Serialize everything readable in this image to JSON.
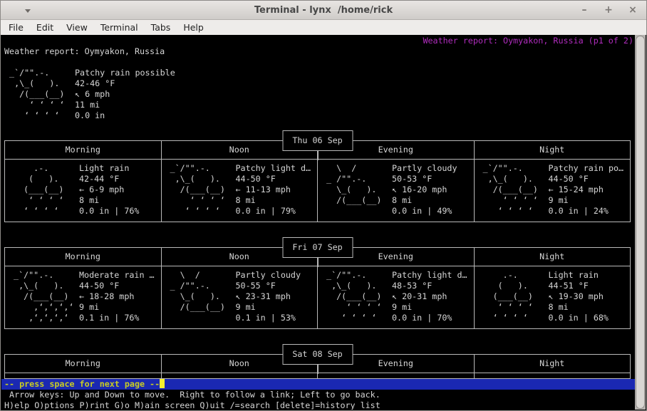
{
  "window": {
    "title": "Terminal - lynx  /home/rick",
    "controls": {
      "minimize": "–",
      "maximize": "+",
      "close": "×"
    }
  },
  "menu": {
    "items": [
      "File",
      "Edit",
      "View",
      "Terminal",
      "Tabs",
      "Help"
    ]
  },
  "lynx": {
    "page_title": "Weather report: Oymyakon, Russia (p1 of 2)",
    "status": "-- press space for next page --",
    "help_line1": " Arrow keys: Up and Down to move.  Right to follow a link; Left to go back.",
    "help_line2": "H)elp O)ptions P)rint G)o M)ain screen Q)uit /=search [delete]=history list"
  },
  "weather": {
    "heading": "Weather report: Oymyakon, Russia",
    "art": {
      "patchy_rain": [
        " _`/\"\".-.",
        "  ,\\_(   ).",
        "   /(___(__)",
        "     ‘ ‘ ‘ ‘",
        "    ‘ ‘ ‘ ‘"
      ],
      "moderate_rain": [
        " _`/\"\".-.",
        "  ,\\_(   ).",
        "   /(___(__)",
        "     ‚‘‚‘‚‘‚‘",
        "    ‚‘‚‘‚‘‚‘"
      ],
      "light_rain": [
        "     .-.",
        "    (   ).",
        "   (___(__)",
        "    ‘ ‘ ‘ ‘",
        "   ‘ ‘ ‘ ‘"
      ],
      "partly_cloudy": [
        "   \\  /",
        " _ /\"\".-.",
        "   \\_(   ).",
        "   /(___(__)",
        ""
      ]
    },
    "current": {
      "art_key": "patchy_rain",
      "condition": "Patchy rain possible",
      "temp": "42-46 °F",
      "wind": "↖ 6 mph",
      "visibility": "11 mi",
      "precip": "0.0 in"
    },
    "days": [
      {
        "date": "Thu 06 Sep",
        "columns": [
          "Morning",
          "Noon",
          "Evening",
          "Night"
        ],
        "periods": [
          {
            "art_key": "light_rain",
            "condition": "Light rain",
            "temp": "42-44 °F",
            "wind": "← 6-9 mph",
            "visibility": "8 mi",
            "precip": "0.0 in | 76%"
          },
          {
            "art_key": "patchy_rain",
            "condition": "Patchy light d…",
            "temp": "44-50 °F",
            "wind": "← 11-13 mph",
            "visibility": "8 mi",
            "precip": "0.0 in | 79%"
          },
          {
            "art_key": "partly_cloudy",
            "condition": "Partly cloudy",
            "temp": "50-53 °F",
            "wind": "↖ 16-20 mph",
            "visibility": "8 mi",
            "precip": "0.0 in | 49%"
          },
          {
            "art_key": "patchy_rain",
            "condition": "Patchy rain po…",
            "temp": "44-50 °F",
            "wind": "← 15-24 mph",
            "visibility": "9 mi",
            "precip": "0.0 in | 24%"
          }
        ]
      },
      {
        "date": "Fri 07 Sep",
        "columns": [
          "Morning",
          "Noon",
          "Evening",
          "Night"
        ],
        "periods": [
          {
            "art_key": "moderate_rain",
            "condition": "Moderate rain …",
            "temp": "44-50 °F",
            "wind": "← 18-28 mph",
            "visibility": "9 mi",
            "precip": "0.1 in | 76%"
          },
          {
            "art_key": "partly_cloudy",
            "condition": "Partly cloudy",
            "temp": "50-55 °F",
            "wind": "↖ 23-31 mph",
            "visibility": "9 mi",
            "precip": "0.1 in | 53%"
          },
          {
            "art_key": "patchy_rain",
            "condition": "Patchy light d…",
            "temp": "48-53 °F",
            "wind": "↖ 20-31 mph",
            "visibility": "9 mi",
            "precip": "0.0 in | 70%"
          },
          {
            "art_key": "light_rain",
            "condition": "Light rain",
            "temp": "44-51 °F",
            "wind": "↖ 19-30 mph",
            "visibility": "8 mi",
            "precip": "0.0 in | 68%"
          }
        ]
      },
      {
        "date": "Sat 08 Sep",
        "columns": [
          "Morning",
          "Noon",
          "Evening",
          "Night"
        ],
        "periods": []
      }
    ]
  },
  "colors": {
    "terminal_bg": "#000000",
    "terminal_fg": "#d6d6d6",
    "border_gray": "#b9b9b9",
    "page_title_magenta": "#b02cbe",
    "status_blue": "#1a28b2",
    "status_yellow": "#c9cd22",
    "cursor_yellow": "#f7ef2e",
    "titlebar_bg": "#dcd9d6",
    "menubar_bg": "#eeecea"
  }
}
